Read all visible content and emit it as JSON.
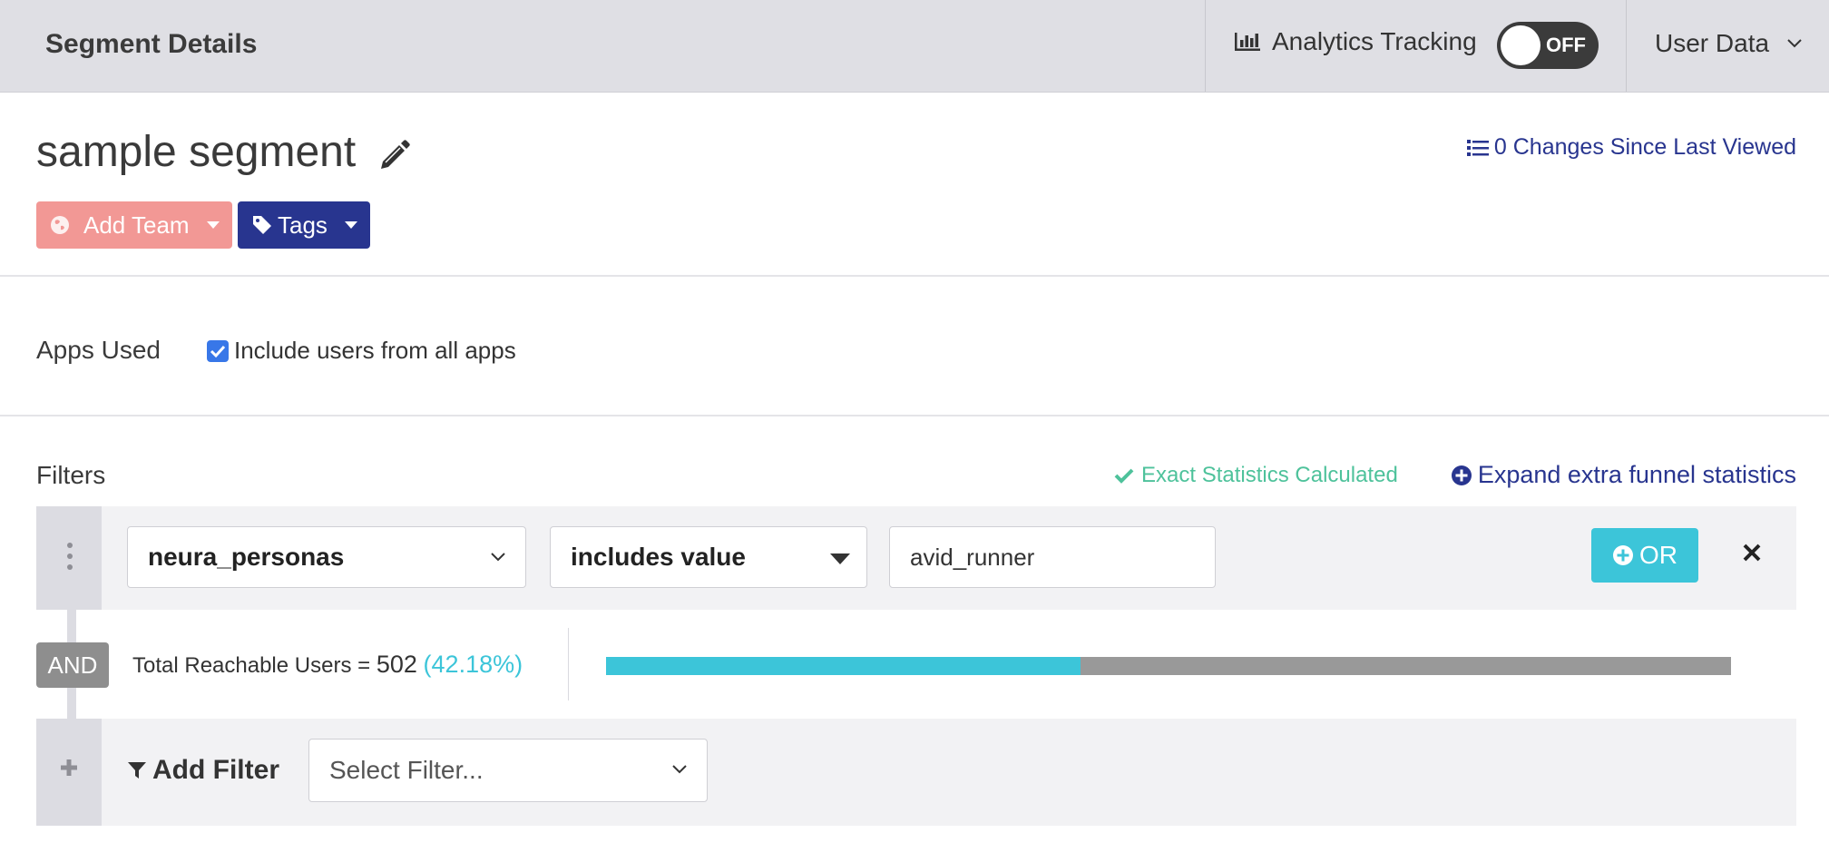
{
  "header": {
    "title": "Segment Details",
    "analytics_label": "Analytics Tracking",
    "toggle_state": "OFF",
    "user_menu": "User Data"
  },
  "segment": {
    "name": "sample segment",
    "changes_link": "0 Changes Since Last Viewed",
    "add_team_label": "Add Team",
    "tags_label": "Tags"
  },
  "apps": {
    "label": "Apps Used",
    "include_all_label": "Include users from all apps",
    "include_all_checked": true
  },
  "filters": {
    "label": "Filters",
    "status": "Exact Statistics Calculated",
    "expand_link": "Expand extra funnel statistics",
    "rows": [
      {
        "property": "neura_personas",
        "operator": "includes value",
        "value": "avid_runner",
        "or_label": "OR"
      }
    ],
    "and_label": "AND",
    "reach": {
      "prefix": "Total Reachable Users = ",
      "count": "502",
      "percent_text": "(42.18%)",
      "fraction": 0.4218
    },
    "add_filter_label": "Add Filter",
    "select_placeholder": "Select Filter..."
  },
  "colors": {
    "header_bg": "#dfdfe4",
    "brand_navy": "#28358f",
    "team_salmon": "#f29895",
    "accent_cyan": "#3cc5d9",
    "success_green": "#4ec29b",
    "bar_gray": "#999999"
  },
  "icons": {
    "analytics": "bar-chart-icon",
    "edit": "pencil-icon",
    "changes": "list-icon",
    "team": "globe-icon",
    "tags": "tag-icon",
    "exact": "check-icon",
    "expand": "plus-circle-icon",
    "remove": "close-icon",
    "add_filter": "funnel-icon"
  }
}
